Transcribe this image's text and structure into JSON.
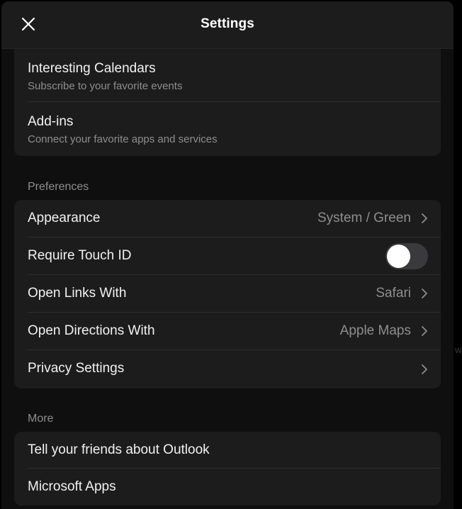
{
  "header": {
    "title": "Settings",
    "close_icon": "close-icon"
  },
  "groups": {
    "top": {
      "items": [
        {
          "title": "Interesting Calendars",
          "subtitle": "Subscribe to your favorite events"
        },
        {
          "title": "Add-ins",
          "subtitle": "Connect your favorite apps and services"
        }
      ]
    },
    "preferences": {
      "label": "Preferences",
      "items": [
        {
          "title": "Appearance",
          "value": "System / Green",
          "icon": "chevron-right-icon"
        },
        {
          "title": "Require Touch ID",
          "toggle_on": false
        },
        {
          "title": "Open Links With",
          "value": "Safari",
          "icon": "chevron-right-icon"
        },
        {
          "title": "Open Directions With",
          "value": "Apple Maps",
          "icon": "chevron-right-icon"
        },
        {
          "title": "Privacy Settings",
          "value": "",
          "icon": "chevron-right-icon"
        }
      ]
    },
    "more": {
      "label": "More",
      "items": [
        {
          "title": "Tell your friends about Outlook"
        },
        {
          "title": "Microsoft Apps"
        }
      ]
    }
  },
  "colors": {
    "background": "#000000",
    "surface": "#1c1c1c",
    "text_primary": "#f2f2f2",
    "text_secondary": "#8e8e8e",
    "toggle_off": "#3a3a3c"
  }
}
